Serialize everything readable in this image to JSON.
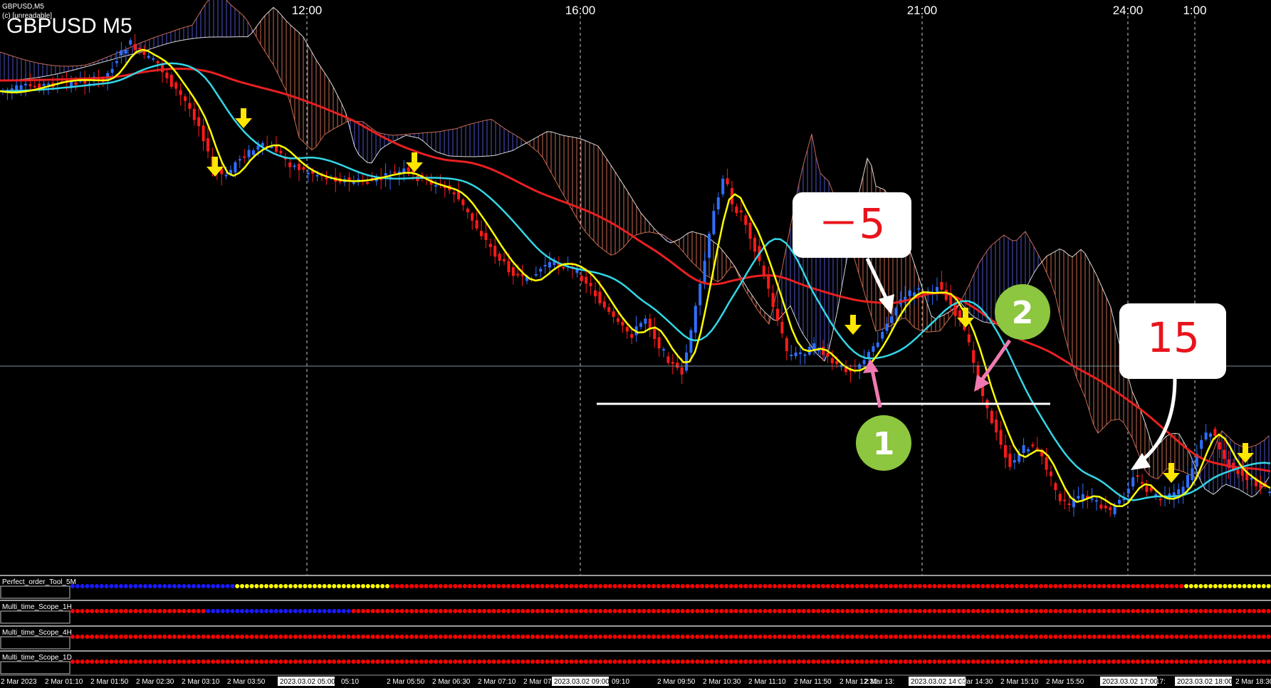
{
  "window": {
    "title_small": "GBPUSD,M5",
    "symbol_label": "GBPUSD M5",
    "copyright": "(c) [unreadable]"
  },
  "top_time_labels": [
    "12:00",
    "16:00",
    "21:00",
    "24:00",
    "1:00"
  ],
  "indicators": [
    {
      "name": "Perfect_order_Tool_5M"
    },
    {
      "name": "Multi_time_Scope_1H"
    },
    {
      "name": "Multi_time_Scope_4H"
    },
    {
      "name": "Multi_time_Scope_1D"
    }
  ],
  "bottom_time_labels": [
    {
      "text": "2 Mar 2023",
      "boxed": false
    },
    {
      "text": "2 Mar 01:10",
      "boxed": false
    },
    {
      "text": "2 Mar 01:50",
      "boxed": false
    },
    {
      "text": "2 Mar 02:30",
      "boxed": false
    },
    {
      "text": "2 Mar 03:10",
      "boxed": false
    },
    {
      "text": "2 Mar 03:50",
      "boxed": false
    },
    {
      "text": "2023.03.02 05:00",
      "boxed": true
    },
    {
      "text": "05:10",
      "boxed": false
    },
    {
      "text": "2 Mar 05:50",
      "boxed": false
    },
    {
      "text": "2 Mar 06:30",
      "boxed": false
    },
    {
      "text": "2 Mar 07:10",
      "boxed": false
    },
    {
      "text": "2 Mar 07:50",
      "boxed": false
    },
    {
      "text": "2023.03.02 09:00",
      "boxed": true
    },
    {
      "text": "09:10",
      "boxed": false
    },
    {
      "text": "2 Mar 09:50",
      "boxed": false
    },
    {
      "text": "2 Mar 10:30",
      "boxed": false
    },
    {
      "text": "2 Mar 11:10",
      "boxed": false
    },
    {
      "text": "2 Mar 11:50",
      "boxed": false
    },
    {
      "text": "2 Mar 12:30",
      "boxed": false
    },
    {
      "text": "2 Mar 13:",
      "boxed": false
    },
    {
      "text": "2023.03.02 14:00",
      "boxed": true
    },
    {
      "text": "2 Mar 14:30",
      "boxed": false
    },
    {
      "text": "2 Mar 15:10",
      "boxed": false
    },
    {
      "text": "2 Mar 15:50",
      "boxed": false
    },
    {
      "text": "2023.03.02 17:00",
      "boxed": true
    },
    {
      "text": "17:",
      "boxed": false
    },
    {
      "text": "2023.03.02 18:00",
      "boxed": true
    },
    {
      "text": "2 Mar 18:30",
      "boxed": false
    }
  ],
  "annotations": {
    "callout_minus5": "－5",
    "callout_15": "15",
    "badge_1": "1",
    "badge_2": "2"
  },
  "colors": {
    "bull_candle": "#2f6fff",
    "bear_candle": "#ff1a1a",
    "ma_fast": "#ffff00",
    "ma_mid": "#33d6e6",
    "ma_slow": "#e82020",
    "cloud_bear": "#c86a50",
    "cloud_bull": "#4b55c8",
    "arrow_signal": "#ffe600",
    "badge": "#8dc63f",
    "pointer_pink": "#f07ab0",
    "dot_red": "#ff0000",
    "dot_blue": "#1a1aff",
    "dot_yellow": "#ffff00"
  }
}
